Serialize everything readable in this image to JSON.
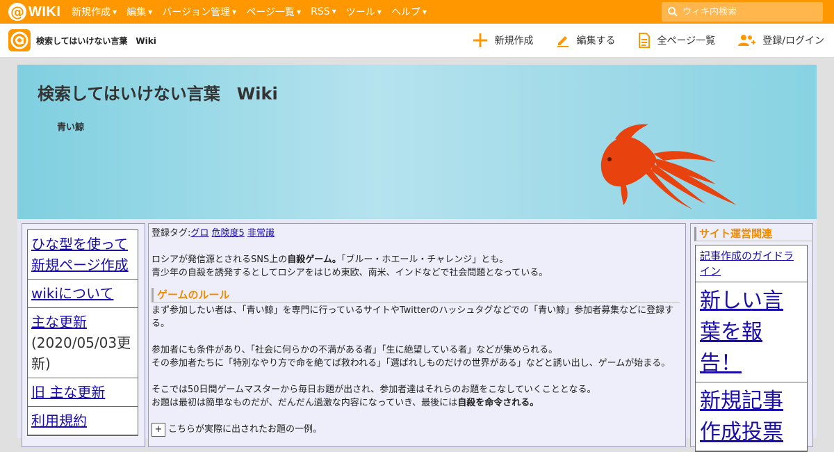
{
  "topbar": {
    "logo_at": "@",
    "logo_text": "WIKI",
    "menu": [
      {
        "label": "新規作成"
      },
      {
        "label": "編集"
      },
      {
        "label": "バージョン管理"
      },
      {
        "label": "ページ一覧"
      },
      {
        "label": "RSS"
      },
      {
        "label": "ツール"
      },
      {
        "label": "ヘルプ"
      }
    ],
    "search_placeholder": "ウィキ内検索"
  },
  "subbar": {
    "title": "検索してはいけない言葉　Wiki",
    "actions": [
      {
        "label": "新規作成",
        "icon": "plus-icon"
      },
      {
        "label": "編集する",
        "icon": "pencil-icon"
      },
      {
        "label": "全ページ一覧",
        "icon": "page-list-icon"
      },
      {
        "label": "登録/ログイン",
        "icon": "users-icon"
      }
    ]
  },
  "banner": {
    "title": "検索してはいけない言葉　Wiki",
    "subtitle": "青い鯨"
  },
  "left_menu": {
    "items": [
      {
        "label": "ひな型を使って新規ページ作成"
      },
      {
        "label": "wikiについて"
      },
      {
        "label": "主な更新",
        "date": "(2020/05/03更新)"
      },
      {
        "label": "旧 主な更新"
      },
      {
        "label": "利用規約"
      }
    ]
  },
  "main": {
    "tags_label": "登録タグ:",
    "tags": [
      "グロ",
      "危険度5",
      "非常識"
    ],
    "p1_a": "ロシアが発信源とされるSNS上の",
    "p1_bold": "自殺ゲーム。",
    "p1_b": "「ブルー・ホエール・チャレンジ」とも。",
    "p2": "青少年の自殺を誘発するとしてロシアをはじめ東欧、南米、インドなどで社会問題となっている。",
    "section_title": "ゲームのルール",
    "p3": "まず参加したい者は、「青い鯨」を専門に行っているサイトやTwitterのハッシュタグなどでの「青い鯨」参加者募集などに登録する。",
    "p4": "参加者にも条件があり、「社会に何らかの不満がある者」「生に絶望している者」などが集められる。",
    "p5": "その参加者たちに「特別なやり方で命を絶てば救われる」「選ばれしものだけの世界がある」などと誘い出し、ゲームが始まる。",
    "p6": "そこでは50日間ゲームマスターから毎日お題が出され、参加者達はそれらのお題をこなしていくこととなる。",
    "p7_a": "お題は最初は簡単なものだが、だんだん過激な内容になっていき、最後には",
    "p7_bold": "自殺を命令される。",
    "expand_symbol": "+",
    "expand_text": "こちらが実際に出されたお題の一例。"
  },
  "right_menu": {
    "heading": "サイト運営関連",
    "items": [
      {
        "label": "記事作成のガイドライン",
        "size": "s"
      },
      {
        "label": "新しい言葉を報告！",
        "size": "b"
      },
      {
        "label": "新規記事作成投票",
        "size": "b"
      }
    ]
  },
  "colors": {
    "accent": "#ff9800",
    "heading": "#f08c00",
    "link": "#1a0dab",
    "fish": "#e8420e"
  }
}
